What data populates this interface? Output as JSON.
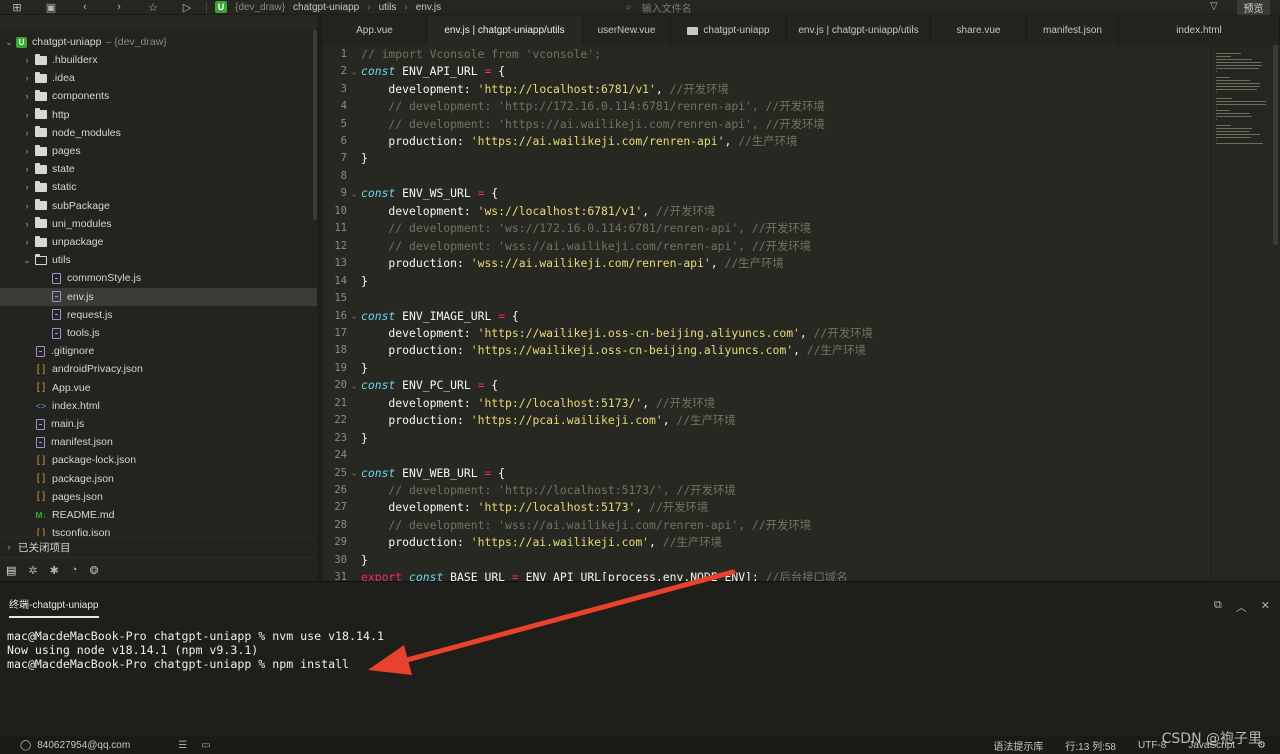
{
  "topbar": {
    "breadcrumb": [
      "{dev_draw}",
      "chatgpt-uniapp",
      "utils",
      "env.js"
    ],
    "project_badge": "U",
    "search_placeholder": "输入文件名",
    "preview_label": "预览"
  },
  "sidebar": {
    "root": {
      "name": "chatgpt-uniapp",
      "workspace": "– {dev_draw}"
    },
    "items": [
      {
        "label": ".hbuilderx",
        "kind": "folder"
      },
      {
        "label": ".idea",
        "kind": "folder"
      },
      {
        "label": "components",
        "kind": "folder"
      },
      {
        "label": "http",
        "kind": "folder"
      },
      {
        "label": "node_modules",
        "kind": "folder"
      },
      {
        "label": "pages",
        "kind": "folder"
      },
      {
        "label": "state",
        "kind": "folder"
      },
      {
        "label": "static",
        "kind": "folder"
      },
      {
        "label": "subPackage",
        "kind": "folder"
      },
      {
        "label": "uni_modules",
        "kind": "folder"
      },
      {
        "label": "unpackage",
        "kind": "folder"
      },
      {
        "label": "utils",
        "kind": "folder-open"
      },
      {
        "label": "commonStyle.js",
        "kind": "js-child"
      },
      {
        "label": "env.js",
        "kind": "js-child",
        "selected": true
      },
      {
        "label": "request.js",
        "kind": "js-child"
      },
      {
        "label": "tools.js",
        "kind": "js-child"
      },
      {
        "label": ".gitignore",
        "kind": "file"
      },
      {
        "label": "androidPrivacy.json",
        "kind": "json"
      },
      {
        "label": "App.vue",
        "kind": "json"
      },
      {
        "label": "index.html",
        "kind": "html"
      },
      {
        "label": "main.js",
        "kind": "js"
      },
      {
        "label": "manifest.json",
        "kind": "manifest"
      },
      {
        "label": "package-lock.json",
        "kind": "json"
      },
      {
        "label": "package.json",
        "kind": "json"
      },
      {
        "label": "pages.json",
        "kind": "json"
      },
      {
        "label": "README.md",
        "kind": "md"
      },
      {
        "label": "tsconfig.json",
        "kind": "json"
      }
    ],
    "closed_projects": "已关闭项目"
  },
  "tabs": [
    {
      "label": "App.vue",
      "width": 104
    },
    {
      "label": "env.js | chatgpt-uniapp/utils",
      "width": 156,
      "active": true
    },
    {
      "label": "userNew.vue",
      "width": 88
    },
    {
      "label": "chatgpt-uniapp",
      "width": 116,
      "folder": true
    },
    {
      "label": "env.js | chatgpt-uniapp/utils",
      "width": 144
    },
    {
      "label": "share.vue",
      "width": 96
    },
    {
      "label": "manifest.json",
      "width": 92
    },
    {
      "label": "index.html",
      "width": 161
    }
  ],
  "editor": {
    "lines": [
      {
        "n": "1",
        "t": [
          [
            "c",
            "// import Vconsole from 'vconsole';"
          ]
        ]
      },
      {
        "n": "2",
        "fold": true,
        "t": [
          [
            "k",
            "const"
          ],
          [
            "p",
            " ENV_API_URL "
          ],
          [
            "o",
            "="
          ],
          [
            "p",
            " {"
          ]
        ]
      },
      {
        "n": "3",
        "t": [
          [
            "p",
            "    development: "
          ],
          [
            "s",
            "'http://localhost:6781/v1'"
          ],
          [
            "p",
            ", "
          ],
          [
            "c",
            "//开发环境"
          ]
        ]
      },
      {
        "n": "4",
        "t": [
          [
            "c",
            "    // development: 'http://172.16.0.114:6781/renren-api', //开发环境"
          ]
        ]
      },
      {
        "n": "5",
        "t": [
          [
            "c",
            "    // development: 'https://ai.wailikeji.com/renren-api', //开发环境"
          ]
        ]
      },
      {
        "n": "6",
        "t": [
          [
            "p",
            "    production: "
          ],
          [
            "s",
            "'https://ai.wailikeji.com/renren-api'"
          ],
          [
            "p",
            ", "
          ],
          [
            "c",
            "//生产环境"
          ]
        ]
      },
      {
        "n": "7",
        "t": [
          [
            "p",
            "}"
          ]
        ]
      },
      {
        "n": "8",
        "t": []
      },
      {
        "n": "9",
        "fold": true,
        "t": [
          [
            "k",
            "const"
          ],
          [
            "p",
            " ENV_WS_URL "
          ],
          [
            "o",
            "="
          ],
          [
            "p",
            " {"
          ]
        ]
      },
      {
        "n": "10",
        "t": [
          [
            "p",
            "    development: "
          ],
          [
            "s",
            "'ws://localhost:6781/v1'"
          ],
          [
            "p",
            ", "
          ],
          [
            "c",
            "//开发环境"
          ]
        ]
      },
      {
        "n": "11",
        "t": [
          [
            "c",
            "    // development: 'ws://172.16.0.114:6781/renren-api', //开发环境"
          ]
        ]
      },
      {
        "n": "12",
        "t": [
          [
            "c",
            "    // development: 'wss://ai.wailikeji.com/renren-api', //开发环境"
          ]
        ]
      },
      {
        "n": "13",
        "t": [
          [
            "p",
            "    production: "
          ],
          [
            "s",
            "'wss://ai.wailikeji.com/renren-api'"
          ],
          [
            "p",
            ", "
          ],
          [
            "c",
            "//生产环境"
          ]
        ]
      },
      {
        "n": "14",
        "t": [
          [
            "p",
            "}"
          ]
        ]
      },
      {
        "n": "15",
        "t": []
      },
      {
        "n": "16",
        "fold": true,
        "t": [
          [
            "k",
            "const"
          ],
          [
            "p",
            " ENV_IMAGE_URL "
          ],
          [
            "o",
            "="
          ],
          [
            "p",
            " {"
          ]
        ]
      },
      {
        "n": "17",
        "t": [
          [
            "p",
            "    development: "
          ],
          [
            "s",
            "'https://wailikeji.oss-cn-beijing.aliyuncs.com'"
          ],
          [
            "p",
            ", "
          ],
          [
            "c",
            "//开发环境"
          ]
        ]
      },
      {
        "n": "18",
        "t": [
          [
            "p",
            "    production: "
          ],
          [
            "s",
            "'https://wailikeji.oss-cn-beijing.aliyuncs.com'"
          ],
          [
            "p",
            ", "
          ],
          [
            "c",
            "//生产环境"
          ]
        ]
      },
      {
        "n": "19",
        "t": [
          [
            "p",
            "}"
          ]
        ]
      },
      {
        "n": "20",
        "fold": true,
        "t": [
          [
            "k",
            "const"
          ],
          [
            "p",
            " ENV_PC_URL "
          ],
          [
            "o",
            "="
          ],
          [
            "p",
            " {"
          ]
        ]
      },
      {
        "n": "21",
        "t": [
          [
            "p",
            "    development: "
          ],
          [
            "s",
            "'http://localhost:5173/'"
          ],
          [
            "p",
            ", "
          ],
          [
            "c",
            "//开发环境"
          ]
        ]
      },
      {
        "n": "22",
        "t": [
          [
            "p",
            "    production: "
          ],
          [
            "s",
            "'https://pcai.wailikeji.com'"
          ],
          [
            "p",
            ", "
          ],
          [
            "c",
            "//生产环境"
          ]
        ]
      },
      {
        "n": "23",
        "t": [
          [
            "p",
            "}"
          ]
        ]
      },
      {
        "n": "24",
        "t": []
      },
      {
        "n": "25",
        "fold": true,
        "t": [
          [
            "k",
            "const"
          ],
          [
            "p",
            " ENV_WEB_URL "
          ],
          [
            "o",
            "="
          ],
          [
            "p",
            " {"
          ]
        ]
      },
      {
        "n": "26",
        "t": [
          [
            "c",
            "    // development: 'http://localhost:5173/', //开发环境"
          ]
        ]
      },
      {
        "n": "27",
        "t": [
          [
            "p",
            "    development: "
          ],
          [
            "s",
            "'http://localhost:5173'"
          ],
          [
            "p",
            ", "
          ],
          [
            "c",
            "//开发环境"
          ]
        ]
      },
      {
        "n": "28",
        "t": [
          [
            "c",
            "    // development: 'wss://ai.wailikeji.com/renren-api', //开发环境"
          ]
        ]
      },
      {
        "n": "29",
        "t": [
          [
            "p",
            "    production: "
          ],
          [
            "s",
            "'https://ai.wailikeji.com'"
          ],
          [
            "p",
            ", "
          ],
          [
            "c",
            "//生产环境"
          ]
        ]
      },
      {
        "n": "30",
        "t": [
          [
            "p",
            "}"
          ]
        ]
      },
      {
        "n": "31",
        "t": [
          [
            "o",
            "export"
          ],
          [
            "p",
            " "
          ],
          [
            "k",
            "const"
          ],
          [
            "p",
            " BASE_URL "
          ],
          [
            "o",
            "="
          ],
          [
            "p",
            " ENV_API_URL[process.env.NODE_ENV]; "
          ],
          [
            "c",
            "//后台接口域名"
          ]
        ]
      }
    ]
  },
  "terminal": {
    "tab_label": "终端-chatgpt-uniapp",
    "lines": [
      "mac@MacdeMacBook-Pro chatgpt-uniapp % nvm use v18.14.1",
      "Now using node v18.14.1 (npm v9.3.1)",
      "mac@MacdeMacBook-Pro chatgpt-uniapp % npm install"
    ]
  },
  "statusbar": {
    "account": "840627954@qq.com",
    "syntax_hint": "语法提示库",
    "position": "行:13  列:58",
    "encoding": "UTF-8",
    "language": "JavaScript"
  },
  "watermark": "CSDN @袍子里",
  "annotation_color": "#e8412c"
}
